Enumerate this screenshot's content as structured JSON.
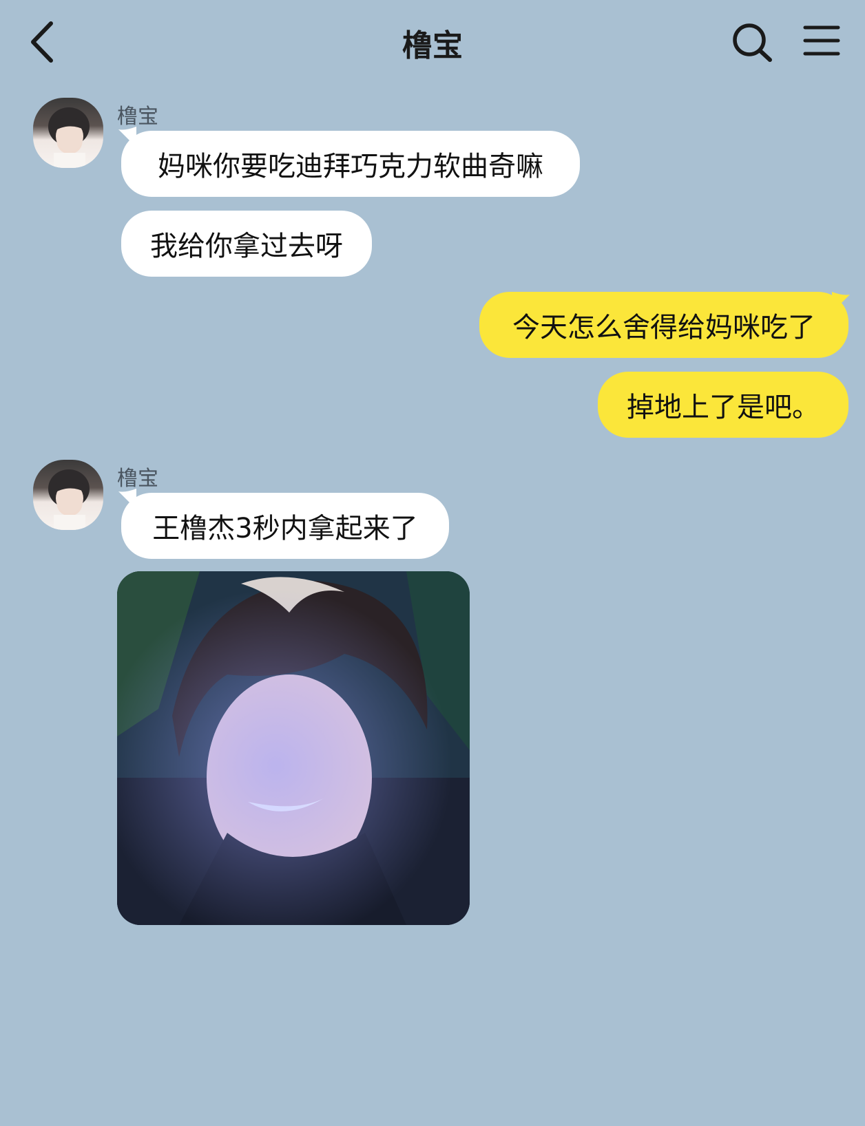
{
  "header": {
    "title": "橹宝",
    "back_icon": "chevron-left-icon",
    "search_icon": "search-icon",
    "menu_icon": "menu-icon"
  },
  "messages": [
    {
      "sender": "橹宝",
      "direction": "incoming",
      "text": "妈咪你要吃迪拜巧克力软曲奇嘛"
    },
    {
      "direction": "incoming",
      "text": "我给你拿过去呀"
    },
    {
      "direction": "outgoing",
      "text": "今天怎么舍得给妈咪吃了"
    },
    {
      "direction": "outgoing",
      "text": "掉地上了是吧。"
    },
    {
      "sender": "橹宝",
      "direction": "incoming",
      "text": "王橹杰3秒内拿起来了"
    },
    {
      "direction": "incoming",
      "type": "image",
      "image": "photo-of-smiling-boy"
    }
  ],
  "colors": {
    "background": "#a9c0d2",
    "incoming_bubble": "#ffffff",
    "outgoing_bubble": "#fbe63a"
  }
}
